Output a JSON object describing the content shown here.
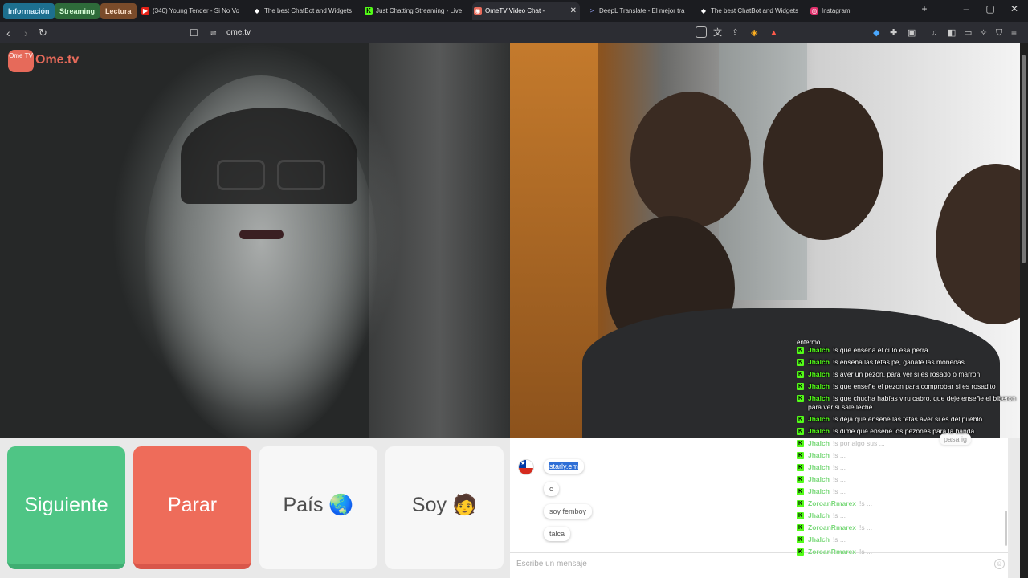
{
  "tab_groups": [
    {
      "label": "Información",
      "color": "#1d6f8f",
      "text": "#d7f0ff"
    },
    {
      "label": "Streaming",
      "color": "#2e6b3a",
      "text": "#d8ffd8"
    },
    {
      "label": "Lectura",
      "color": "#7a4b2a",
      "text": "#ffe3cc"
    }
  ],
  "tabs": [
    {
      "title": "(340) Young Tender - Si No Vo",
      "icon": "youtube-icon",
      "icon_color": "#e62117"
    },
    {
      "title": "The best ChatBot and Widgets",
      "icon": "streamelements-icon",
      "icon_color": "#ffffff"
    },
    {
      "title": "Just Chatting Streaming - Live",
      "icon": "kick-icon",
      "icon_color": "#53fc18"
    },
    {
      "title": "OmeTV Video Chat -",
      "icon": "ometv-icon",
      "icon_color": "#e66a5a",
      "active": true
    },
    {
      "title": "DeepL Translate - El mejor tra",
      "icon": "deepl-icon",
      "icon_color": "#9aa7ff"
    },
    {
      "title": "The best ChatBot and Widgets",
      "icon": "streamelements-icon",
      "icon_color": "#ffffff"
    },
    {
      "title": "Instagram",
      "icon": "instagram-icon",
      "icon_color": "#e1306c"
    }
  ],
  "url": "ome.tv",
  "logo": {
    "badge": "Ome TV",
    "text": "Ome.tv"
  },
  "buttons": {
    "next": "Siguiente",
    "stop": "Parar",
    "country": "País 🌏",
    "me": "Soy 🧑"
  },
  "chat": {
    "messages": [
      {
        "text": "starly.em",
        "selected": true
      },
      {
        "text": "c"
      },
      {
        "text": "soy femboy"
      },
      {
        "text": "talca"
      }
    ],
    "input_placeholder": "Escribe un mensaje",
    "quick_reply": "pasa ig"
  },
  "overlay_chat": {
    "top_fragment": "enfermo",
    "lines": [
      {
        "user": "Jhalch",
        "text": "!s que enseña el culo esa perra",
        "faded": false
      },
      {
        "user": "Jhalch",
        "text": "!s enseña las tetas pe, ganate las monedas",
        "faded": false
      },
      {
        "user": "Jhalch",
        "text": "!s aver un pezon, para ver si es rosado o marron",
        "faded": false
      },
      {
        "user": "Jhalch",
        "text": "!s que enseñe el pezon para comprobar si es rosadito",
        "faded": false
      },
      {
        "user": "Jhalch",
        "text": "!s que chucha habías viru cabro, que deje enseñe el biberon para ver si sale leche",
        "faded": false
      },
      {
        "user": "Jhalch",
        "text": "!s deja que enseñe las tetas aver si es del pueblo",
        "faded": false
      },
      {
        "user": "Jhalch",
        "text": "!s dime que enseñe los pezones para la banda",
        "faded": false
      },
      {
        "user": "Jhalch",
        "text": "!s por algo sus ...",
        "faded": true
      },
      {
        "user": "Jhalch",
        "text": "!s ...",
        "faded": true
      },
      {
        "user": "Jhalch",
        "text": "!s ...",
        "faded": true
      },
      {
        "user": "Jhalch",
        "text": "!s ...",
        "faded": true
      },
      {
        "user": "Jhalch",
        "text": "!s ...",
        "faded": true
      },
      {
        "user": "ZoroanRmarex",
        "text": "!s ...",
        "faded": true
      },
      {
        "user": "Jhalch",
        "text": "!s ...",
        "faded": true
      },
      {
        "user": "ZoroanRmarex",
        "text": "!s ...",
        "faded": true
      },
      {
        "user": "Jhalch",
        "text": "!s ...",
        "faded": true
      },
      {
        "user": "ZoroanRmarex",
        "text": "!s ...",
        "faded": true
      }
    ]
  }
}
